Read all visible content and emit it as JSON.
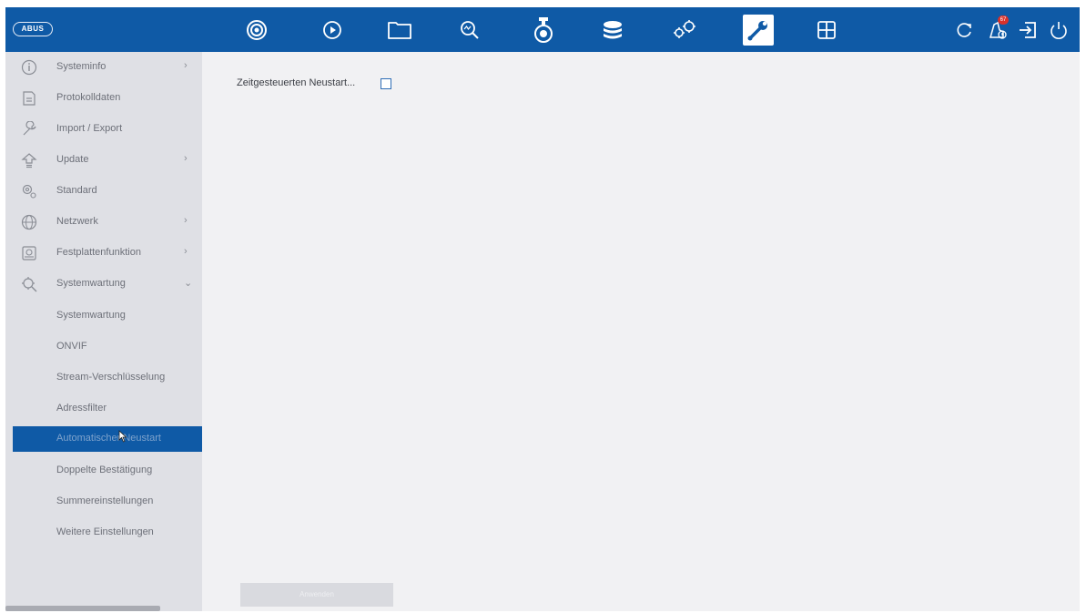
{
  "header": {
    "logo_text": "ABUS",
    "badge_count": "67",
    "nav_icons": [
      "live-view-icon",
      "playback-icon",
      "file-manager-icon",
      "smart-search-icon",
      "camera-icon",
      "storage-icon",
      "configuration-icon",
      "maintenance-icon",
      "layout-grid-icon"
    ],
    "active_icon": "maintenance-icon",
    "right_icons": [
      "refresh-icon",
      "alarm-icon",
      "logout-icon",
      "power-icon"
    ]
  },
  "sidebar": {
    "items": [
      {
        "label": "Systeminfo",
        "icon": "info-icon",
        "has_submenu": true,
        "arrow": "›"
      },
      {
        "label": "Protokolldaten",
        "icon": "log-file-icon",
        "has_submenu": false
      },
      {
        "label": "Import / Export",
        "icon": "wrench-icon",
        "has_submenu": false
      },
      {
        "label": "Update",
        "icon": "upgrade-icon",
        "has_submenu": true,
        "arrow": "›"
      },
      {
        "label": "Standard",
        "icon": "default-settings-icon",
        "has_submenu": false
      },
      {
        "label": "Netzwerk",
        "icon": "network-globe-icon",
        "has_submenu": true,
        "arrow": "›"
      },
      {
        "label": "Festplattenfunktion",
        "icon": "hdd-icon",
        "has_submenu": true,
        "arrow": "›"
      },
      {
        "label": "Systemwartung",
        "icon": "system-maintenance-icon",
        "has_submenu": true,
        "arrow": "⌄",
        "expanded": true
      }
    ],
    "subitems": [
      {
        "label": "Systemwartung"
      },
      {
        "label": "ONVIF"
      },
      {
        "label": "Stream-Verschlüsselung"
      },
      {
        "label": "Adressfilter"
      },
      {
        "label": "Automatischer Neustart",
        "selected": true
      },
      {
        "label": "Doppelte Bestätigung"
      },
      {
        "label": "Summereinstellungen"
      },
      {
        "label": "Weitere Einstellungen"
      }
    ]
  },
  "main": {
    "restart_label": "Zeitgesteuerten Neustart...",
    "restart_checked": false,
    "apply_label": "Anwenden"
  },
  "colors": {
    "topbar": "#0f5aa6",
    "sidebar": "#dfe0e5",
    "content": "#f1f1f3",
    "selected": "#0f5aa6"
  }
}
